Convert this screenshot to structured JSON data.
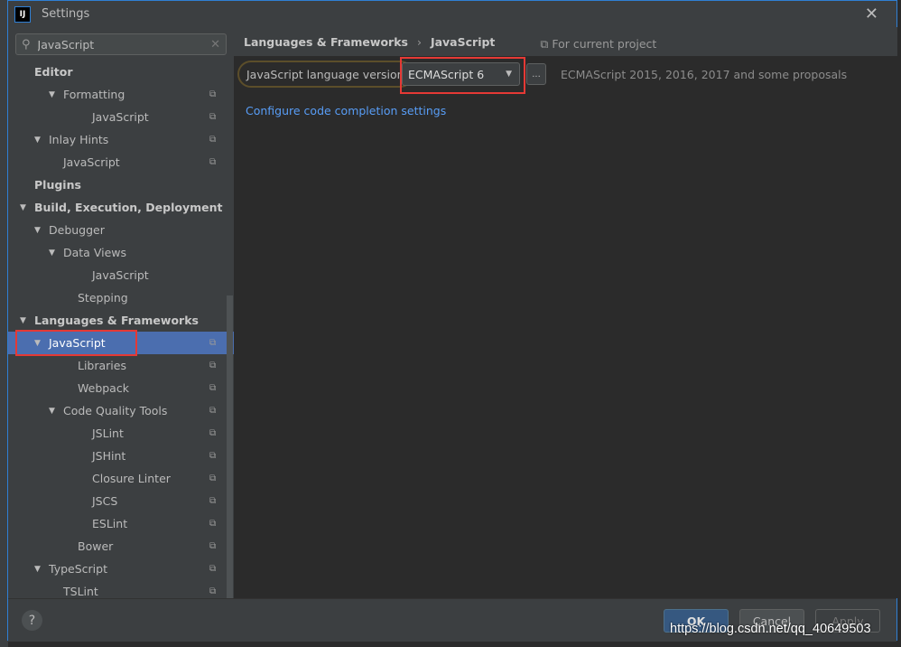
{
  "window": {
    "title": "Settings",
    "app_icon": "IJ",
    "close_icon": "close-icon"
  },
  "search": {
    "value": "JavaScript"
  },
  "tree": [
    {
      "label": "Editor",
      "level": 0,
      "bold": true,
      "arrow": false,
      "copy": false
    },
    {
      "label": "Formatting",
      "level": 1,
      "arrow": true,
      "copy": true
    },
    {
      "label": "JavaScript",
      "level": 2,
      "arrow": false,
      "copy": true
    },
    {
      "label": "Inlay Hints",
      "level": 0.5,
      "arrow": true,
      "copy": true
    },
    {
      "label": "JavaScript",
      "level": 1,
      "arrow": false,
      "copy": true
    },
    {
      "label": "Plugins",
      "level": 0,
      "bold": true,
      "arrow": false,
      "copy": false
    },
    {
      "label": "Build, Execution, Deployment",
      "level": -1,
      "bold": true,
      "arrow": true,
      "copy": false
    },
    {
      "label": "Debugger",
      "level": 0.5,
      "arrow": true,
      "copy": false
    },
    {
      "label": "Data Views",
      "level": 1,
      "arrow": true,
      "copy": false
    },
    {
      "label": "JavaScript",
      "level": 2,
      "arrow": false,
      "copy": false
    },
    {
      "label": "Stepping",
      "level": 1.5,
      "arrow": false,
      "copy": false
    },
    {
      "label": "Languages & Frameworks",
      "level": -1,
      "bold": true,
      "arrow": true,
      "copy": false
    },
    {
      "label": "JavaScript",
      "level": 0.5,
      "arrow": true,
      "copy": true,
      "selected": true
    },
    {
      "label": "Libraries",
      "level": 1.5,
      "arrow": false,
      "copy": true
    },
    {
      "label": "Webpack",
      "level": 1.5,
      "arrow": false,
      "copy": true
    },
    {
      "label": "Code Quality Tools",
      "level": 1,
      "arrow": true,
      "copy": true
    },
    {
      "label": "JSLint",
      "level": 2,
      "arrow": false,
      "copy": true
    },
    {
      "label": "JSHint",
      "level": 2,
      "arrow": false,
      "copy": true
    },
    {
      "label": "Closure Linter",
      "level": 2,
      "arrow": false,
      "copy": true
    },
    {
      "label": "JSCS",
      "level": 2,
      "arrow": false,
      "copy": true
    },
    {
      "label": "ESLint",
      "level": 2,
      "arrow": false,
      "copy": true
    },
    {
      "label": "Bower",
      "level": 1.5,
      "arrow": false,
      "copy": true
    },
    {
      "label": "TypeScript",
      "level": 0.5,
      "arrow": true,
      "copy": true
    },
    {
      "label": "TSLint",
      "level": 1,
      "arrow": false,
      "copy": true
    }
  ],
  "breadcrumb": {
    "parent": "Languages & Frameworks",
    "current": "JavaScript",
    "scope": "For current project"
  },
  "main": {
    "version_label": "JavaScript language version",
    "version_value": "ECMAScript 6",
    "more_label": "...",
    "version_desc": "ECMAScript 2015, 2016, 2017 and some proposals",
    "completion_link": "Configure code completion settings"
  },
  "footer": {
    "help": "?",
    "ok": "OK",
    "cancel": "Cancel",
    "apply": "Apply"
  },
  "watermark": "https://blog.csdn.net/qq_40649503",
  "colors": {
    "highlight": "#e53935",
    "selection": "#4b6eaf",
    "link": "#589df6"
  }
}
